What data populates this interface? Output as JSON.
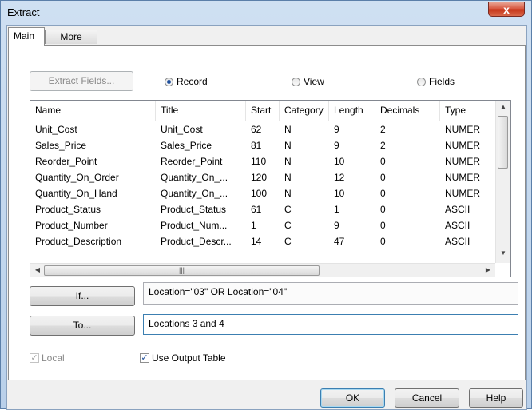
{
  "window": {
    "title": "Extract",
    "close_glyph": "x"
  },
  "tabs": [
    {
      "label": "Main"
    },
    {
      "label": "More"
    }
  ],
  "extract_fields_button": "Extract Fields...",
  "radios": [
    {
      "label": "Record",
      "selected": true
    },
    {
      "label": "View",
      "selected": false
    },
    {
      "label": "Fields",
      "selected": false
    }
  ],
  "list": {
    "columns": [
      "Name",
      "Title",
      "Start",
      "Category",
      "Length",
      "Decimals",
      "Type"
    ],
    "rows": [
      [
        "Unit_Cost",
        "Unit_Cost",
        "62",
        "N",
        "9",
        "2",
        "NUMER"
      ],
      [
        "Sales_Price",
        "Sales_Price",
        "81",
        "N",
        "9",
        "2",
        "NUMER"
      ],
      [
        "Reorder_Point",
        "Reorder_Point",
        "110",
        "N",
        "10",
        "0",
        "NUMER"
      ],
      [
        "Quantity_On_Order",
        "Quantity_On_...",
        "120",
        "N",
        "12",
        "0",
        "NUMER"
      ],
      [
        "Quantity_On_Hand",
        "Quantity_On_...",
        "100",
        "N",
        "10",
        "0",
        "NUMER"
      ],
      [
        "Product_Status",
        "Product_Status",
        "61",
        "C",
        "1",
        "0",
        "ASCII"
      ],
      [
        "Product_Number",
        "Product_Num...",
        "1",
        "C",
        "9",
        "0",
        "ASCII"
      ],
      [
        "Product_Description",
        "Product_Descr...",
        "14",
        "C",
        "47",
        "0",
        "ASCII"
      ]
    ]
  },
  "if_button": "If...",
  "if_value": "Location=\"03\" OR Location=\"04\"",
  "to_button": "To...",
  "to_value": "Locations 3 and 4",
  "local_label": "Local",
  "use_output_table_label": "Use Output Table",
  "footer": {
    "ok": "OK",
    "cancel": "Cancel",
    "help": "Help"
  }
}
